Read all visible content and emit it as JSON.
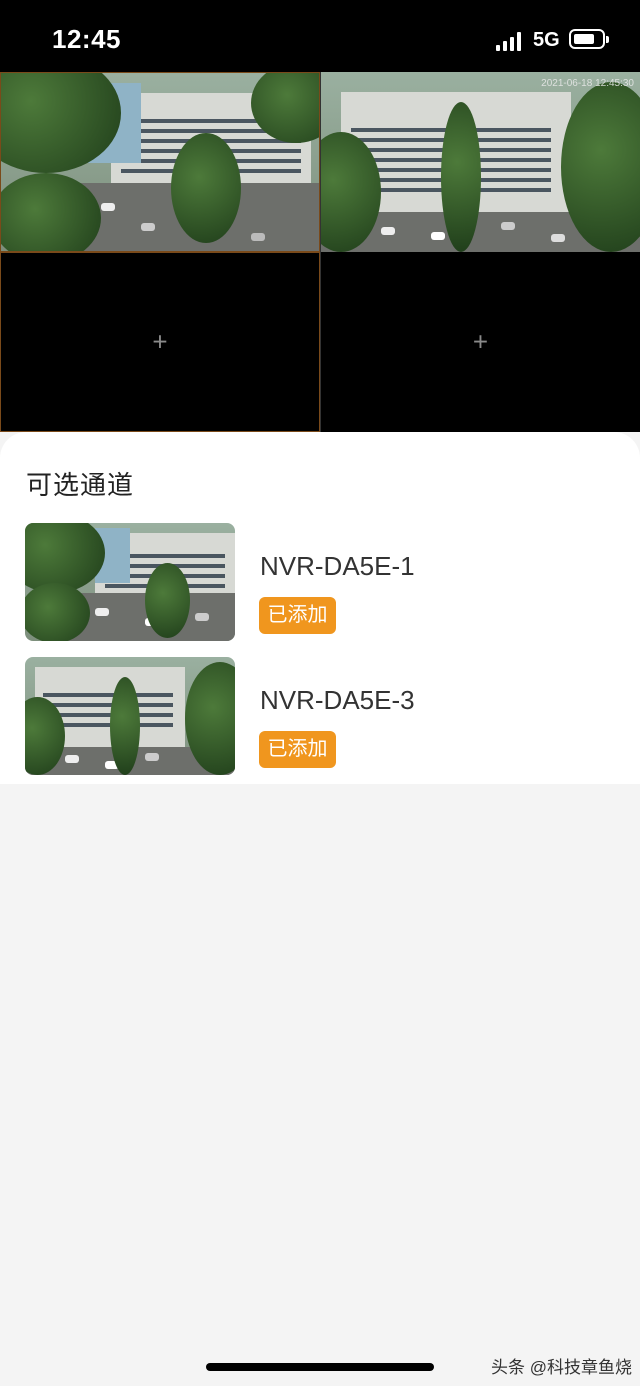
{
  "status_bar": {
    "time": "12:45",
    "network": "5G"
  },
  "camera_grid": {
    "timestamp_overlay": "2021-06-18 12:45:30",
    "add_symbol": "+"
  },
  "sheet": {
    "title": "可选通道",
    "channels": [
      {
        "name": "NVR-DA5E-1",
        "status": "已添加"
      },
      {
        "name": "NVR-DA5E-3",
        "status": "已添加"
      }
    ]
  },
  "watermark": "头条 @科技章鱼烧",
  "colors": {
    "accent": "#f0961e",
    "background": "#f4f4f4"
  }
}
